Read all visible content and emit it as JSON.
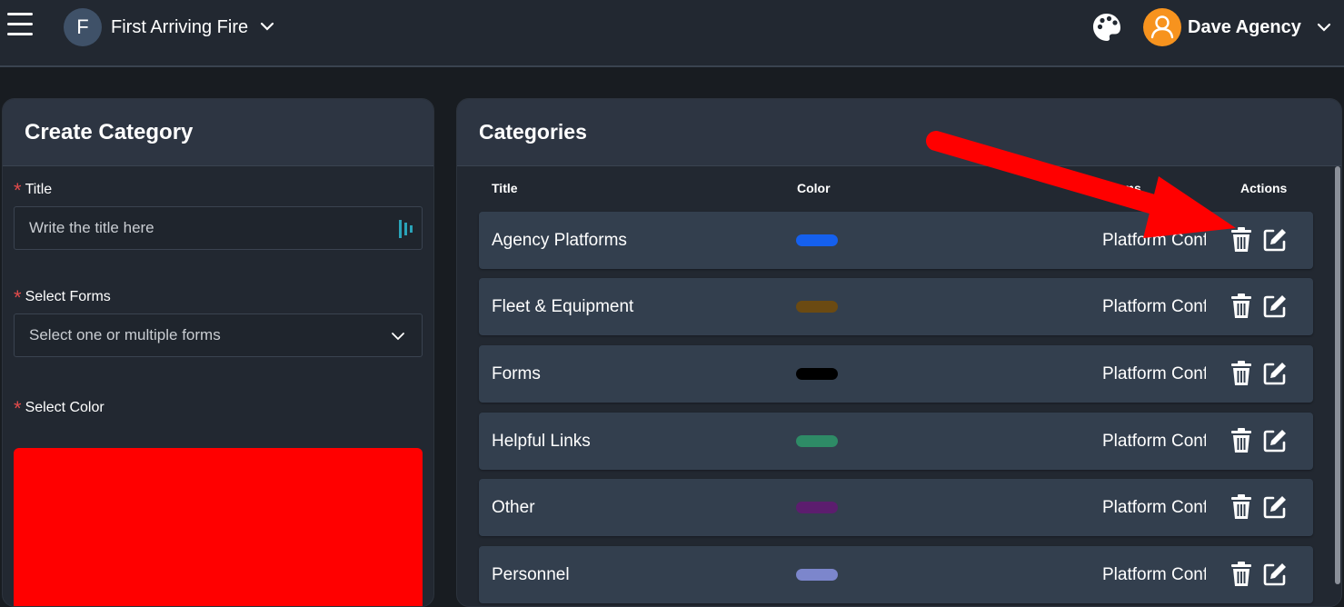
{
  "topbar": {
    "org_initial": "F",
    "org_name": "First Arriving Fire",
    "user_name": "Dave Agency"
  },
  "create_panel": {
    "title": "Create Category",
    "title_field": {
      "label": "Title",
      "placeholder": "Write the title here"
    },
    "forms_field": {
      "label": "Select Forms",
      "placeholder": "Select one or multiple forms"
    },
    "color_field": {
      "label": "Select Color",
      "selected_color": "#ff0000"
    },
    "required_mark": "*"
  },
  "categories_panel": {
    "title": "Categories",
    "headers": {
      "title": "Title",
      "color": "Color",
      "forms": "Forms",
      "actions": "Actions"
    },
    "rows": [
      {
        "title": "Agency Platforms",
        "color": "#1560ee",
        "forms": "Platform Config"
      },
      {
        "title": "Fleet & Equipment",
        "color": "#6b4a12",
        "forms": "Platform Config"
      },
      {
        "title": "Forms",
        "color": "#000000",
        "forms": "Platform Config"
      },
      {
        "title": "Helpful Links",
        "color": "#2e8b66",
        "forms": "Platform Config"
      },
      {
        "title": "Other",
        "color": "#5c1d6e",
        "forms": "Platform Config"
      },
      {
        "title": "Personnel",
        "color": "#7c86cc",
        "forms": "Platform Config"
      }
    ]
  },
  "icons": {
    "menu": "hamburger-icon",
    "palette": "palette-icon",
    "user": "user-icon",
    "delete": "trash-icon",
    "edit": "edit-icon"
  },
  "colors": {
    "accent_orange": "#f7931e",
    "annotation_arrow": "#ff0000",
    "required": "#e24b4b"
  }
}
